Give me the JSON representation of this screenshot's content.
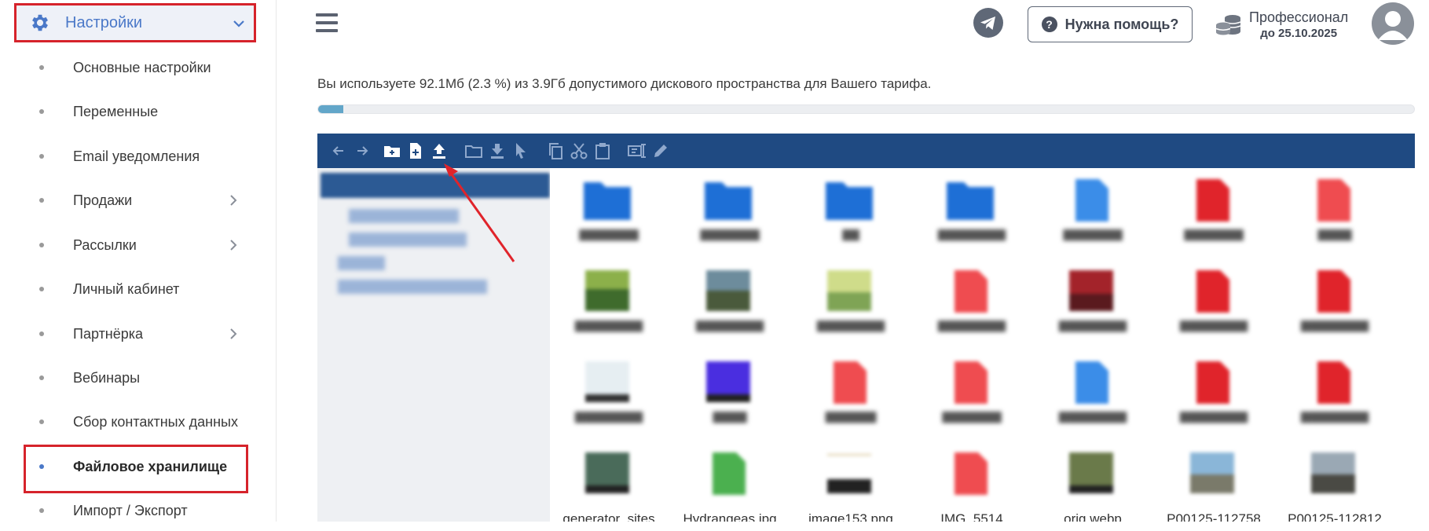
{
  "sidebar": {
    "header": {
      "label": "Настройки"
    },
    "items": [
      {
        "label": "Основные настройки",
        "has_arrow": false
      },
      {
        "label": "Переменные",
        "has_arrow": false
      },
      {
        "label": "Email уведомления",
        "has_arrow": false
      },
      {
        "label": "Продажи",
        "has_arrow": true
      },
      {
        "label": "Рассылки",
        "has_arrow": true
      },
      {
        "label": "Личный кабинет",
        "has_arrow": false
      },
      {
        "label": "Партнёрка",
        "has_arrow": true
      },
      {
        "label": "Вебинары",
        "has_arrow": false
      },
      {
        "label": "Сбор контактных данных",
        "has_arrow": false
      },
      {
        "label": "Файловое хранилище",
        "has_arrow": false,
        "active": true
      },
      {
        "label": "Импорт / Экспорт",
        "has_arrow": false
      }
    ]
  },
  "header": {
    "help_label": "Нужна помощь?",
    "plan_name": "Профессионал",
    "plan_until": "до 25.10.2025"
  },
  "storage": {
    "usage_text": "Вы используете 92.1Мб (2.3 %) из 3.9Гб допустимого дискового пространства для Вашего тарифа.",
    "percent_used": 2.3
  },
  "file_manager": {
    "files": [
      {
        "name": "generator_sites"
      },
      {
        "name": "Hydrangeas.jpg"
      },
      {
        "name": "image153.png"
      },
      {
        "name": "IMG_5514"
      },
      {
        "name": "orig.webp"
      },
      {
        "name": "P00125-112758"
      },
      {
        "name": "P00125-112812"
      }
    ]
  },
  "colors": {
    "accent": "#4a78c8",
    "highlight": "#d6232b",
    "toolbar": "#1f4a82",
    "folder": "#1e6fd6",
    "pdf": "#e0242b"
  }
}
